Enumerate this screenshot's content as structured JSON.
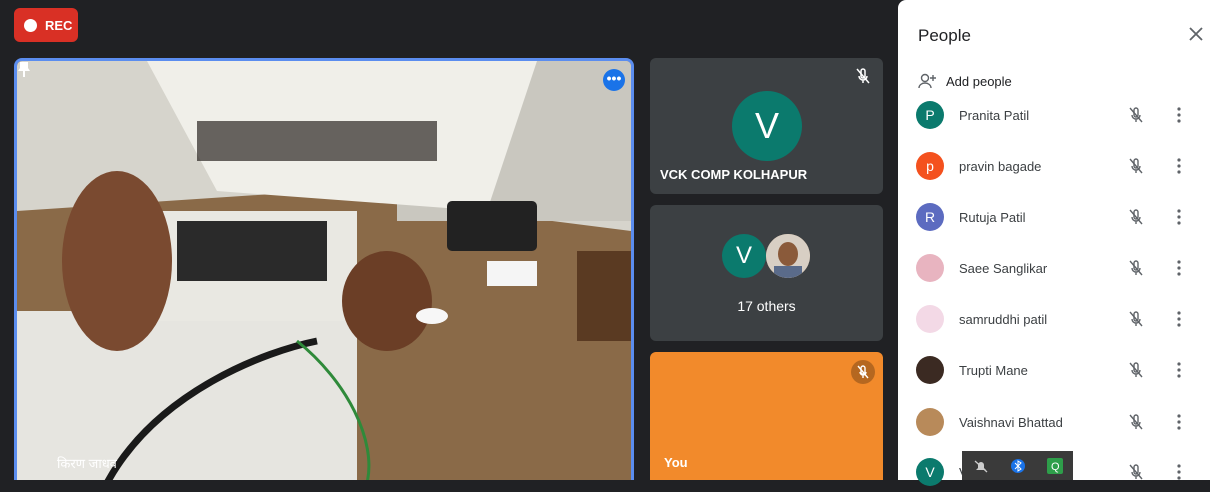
{
  "recording": {
    "label": "REC"
  },
  "main_tile": {
    "name": "किरण जाधव"
  },
  "tiles": [
    {
      "name": "VCK COMP KOLHAPUR",
      "initial": "V"
    },
    {
      "initial": "V",
      "others": "17 others"
    },
    {
      "name": "You"
    }
  ],
  "panel": {
    "title": "People",
    "add_people": "Add people",
    "participants": [
      {
        "initial": "P",
        "name": "Pranita Patil",
        "color": "#0b7a6d"
      },
      {
        "initial": "p",
        "name": "pravin bagade",
        "color": "#f4511e"
      },
      {
        "initial": "R",
        "name": "Rutuja Patil",
        "color": "#5c6bc0"
      },
      {
        "initial": "",
        "name": "Saee Sanglikar",
        "color": "#e8b4c0"
      },
      {
        "initial": "",
        "name": "samruddhi patil",
        "color": "#f3d9e6"
      },
      {
        "initial": "",
        "name": "Trupti Mane",
        "color": "#3b2a22"
      },
      {
        "initial": "",
        "name": "Vaishnavi Bhattad",
        "color": "#b88a5a"
      },
      {
        "initial": "V",
        "name": "V",
        "color": "#0b7a6d"
      }
    ]
  },
  "colors": {
    "accent": "#1a73e8",
    "rec": "#d93025",
    "you_tile": "#f28a2b"
  }
}
